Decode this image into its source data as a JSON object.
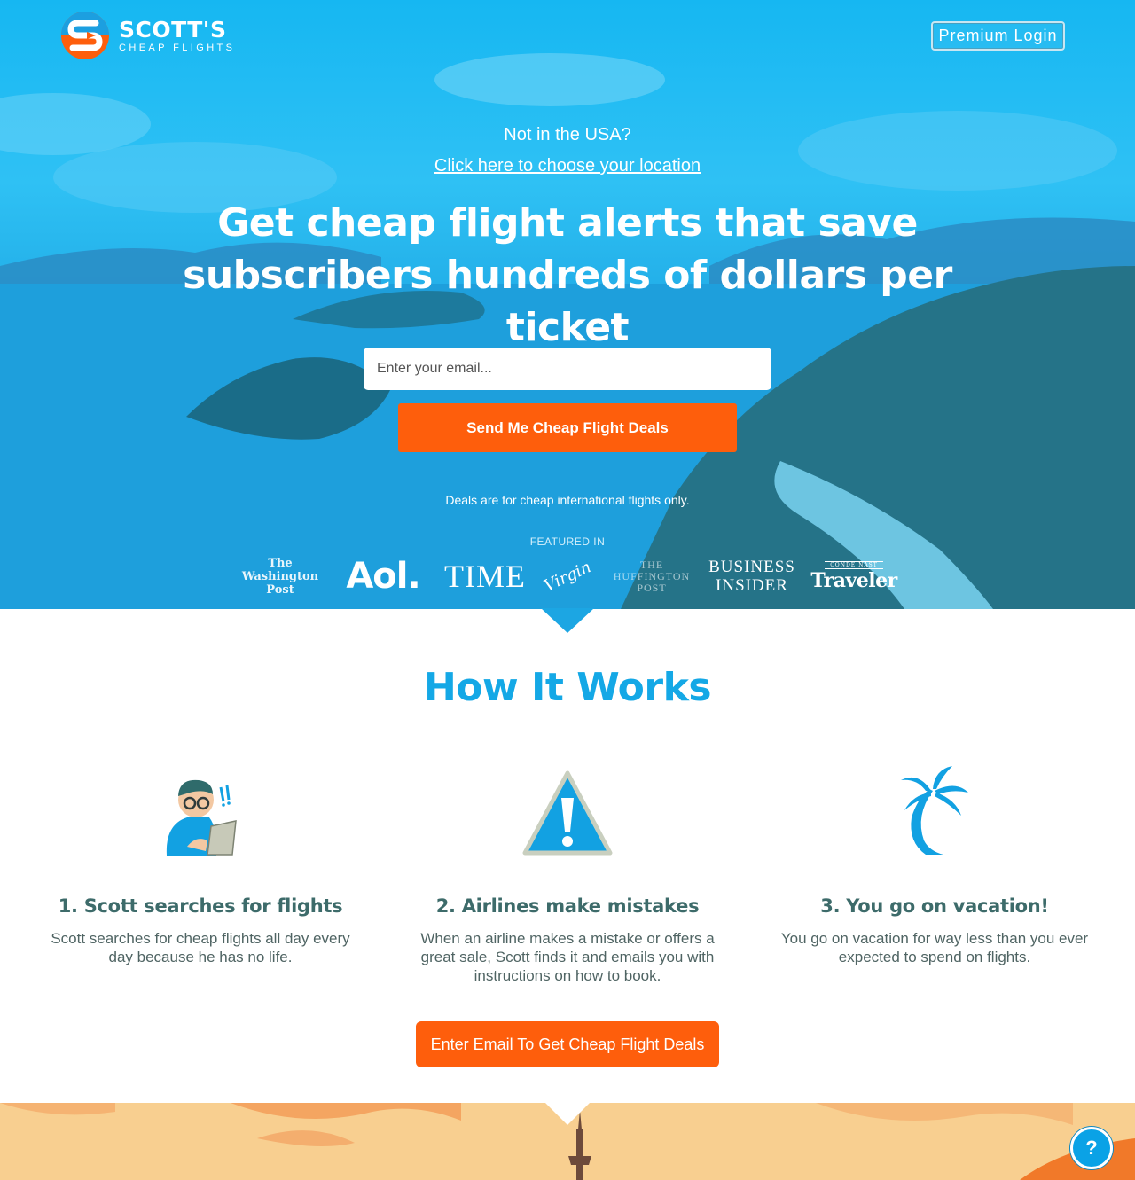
{
  "brand": {
    "name": "SCOTT'S",
    "tagline": "CHEAP FLIGHTS"
  },
  "header": {
    "premium_login": "Premium Login"
  },
  "hero": {
    "location_question": "Not in the USA?",
    "location_link": "Click here to choose your location",
    "headline_line1": "Get cheap flight alerts that save",
    "headline_line2": "subscribers hundreds of dollars per ticket",
    "email_placeholder": "Enter your email...",
    "submit_label": "Send Me Cheap Flight Deals",
    "note": "Deals are for cheap international flights only.",
    "featured_label": "FEATURED IN",
    "press": {
      "wapo_line1": "The",
      "wapo_line2": "Washington",
      "wapo_line3": "Post",
      "aol": "Aol.",
      "time": "TIME",
      "virgin": "Virgin",
      "huff_line1": "THE",
      "huff_line2": "HUFFINGTON",
      "huff_line3": "POST",
      "bi_line1": "BUSINESS",
      "bi_line2": "INSIDER",
      "traveler_top": "CONDÉ NAST",
      "traveler": "Traveler"
    }
  },
  "how_it_works": {
    "title": "How It Works",
    "steps": [
      {
        "title": "1. Scott searches for flights",
        "description": "Scott searches for cheap flights all day every day because he has no life.",
        "icon": "scott-laptop-icon"
      },
      {
        "title": "2. Airlines make mistakes",
        "description": "When an airline makes a mistake or offers a great sale, Scott finds it and emails you with instructions on how to book.",
        "icon": "warning-icon"
      },
      {
        "title": "3. You go on vacation!",
        "description": "You go on vacation for way less than you ever expected to spend on flights.",
        "icon": "palm-tree-icon"
      }
    ],
    "cta_label": "Enter Email To Get Cheap Flight Deals"
  },
  "help": {
    "label": "?"
  },
  "colors": {
    "accent": "#fe5e0c",
    "sky": "#16b7f2",
    "heading_blue": "#14a8e6",
    "step_title": "#3d6b6a",
    "sand": "#f8cf90"
  }
}
